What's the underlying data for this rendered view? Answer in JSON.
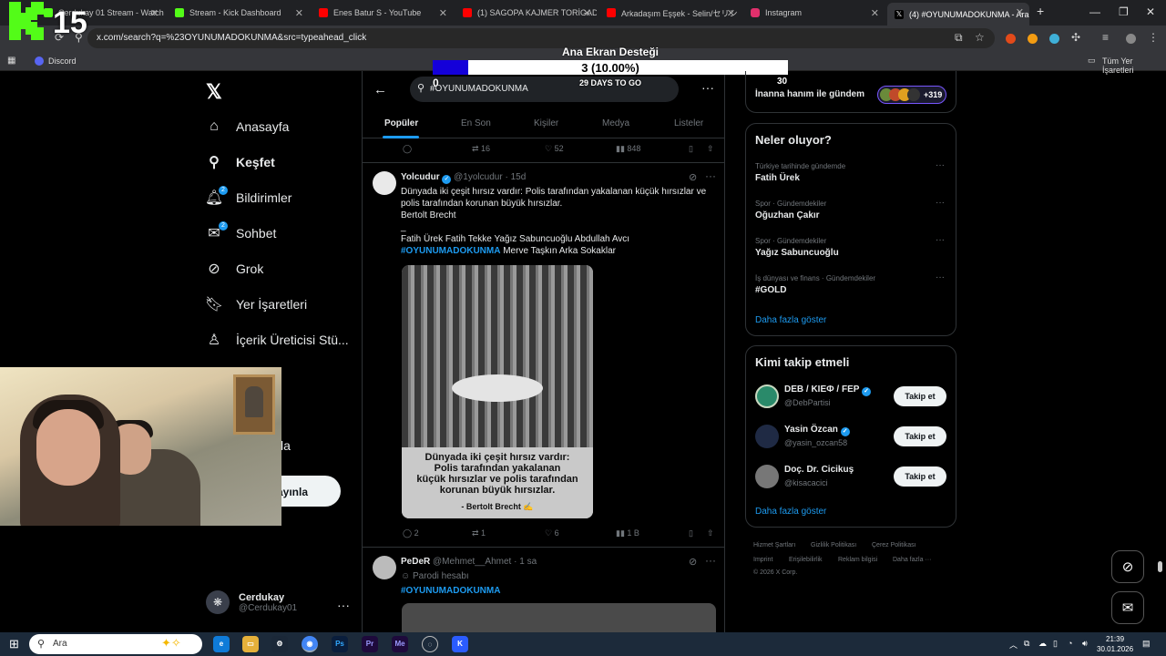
{
  "browser": {
    "tabs": [
      {
        "title": "Cerdukay 01 Stream - Watch Live",
        "color": "#53fc18"
      },
      {
        "title": "Stream - Kick Dashboard",
        "color": "#53fc18"
      },
      {
        "title": "Enes Batur S - YouTube",
        "color": "#ff0000"
      },
      {
        "title": "(1) SAGOPA KAJMER TORİGADİ",
        "color": "#ff0000"
      },
      {
        "title": "Arkadaşım Eşşek - Selin/セリン",
        "color": "#ff0000"
      },
      {
        "title": "Instagram",
        "color": "#e1306c"
      },
      {
        "title": "(4) #OYUNUMADOKUNMA - Arama",
        "color": "#ffffff"
      }
    ],
    "new_tab": "+",
    "url": "x.com/search?q=%23OYUNUMADOKUNMA&src=typeahead_click",
    "bookmarks": [
      {
        "label": "Discord"
      }
    ],
    "all_bookmarks": "Tüm Yer İşaretleri"
  },
  "overlay": {
    "kick_counter": "15",
    "goal_title": "Ana Ekran Desteği",
    "goal_text": "3 (10.00%)",
    "goal_fraction": 0.1,
    "goal_start": "0",
    "goal_end": "30",
    "goal_days": "29 DAYS TO GO"
  },
  "nav": {
    "items": [
      {
        "label": "Anasayfa",
        "icon": "home-icon",
        "badge": ""
      },
      {
        "label": "Keşfet",
        "icon": "search-icon",
        "badge": ""
      },
      {
        "label": "Bildirimler",
        "icon": "bell-icon",
        "badge": "2"
      },
      {
        "label": "Sohbet",
        "icon": "mail-icon",
        "badge": "2"
      },
      {
        "label": "Grok",
        "icon": "grok-icon",
        "badge": ""
      },
      {
        "label": "Yer İşaretleri",
        "icon": "bookmark-icon",
        "badge": ""
      },
      {
        "label": "İçerik Üreticisi Stü...",
        "icon": "creator-studio-icon",
        "badge": ""
      }
    ],
    "hidden_fragment": "la",
    "post_button": "ayınla",
    "account_name": "Cerdukay",
    "account_handle": "@Cerdukay01"
  },
  "search": {
    "query": "#OYUNUMADOKUNMA",
    "tabs": [
      "Popüler",
      "En Son",
      "Kişiler",
      "Medya",
      "Listeler"
    ]
  },
  "tweets": [
    {
      "reply_count": "",
      "retweet_count": "16",
      "like_count": "52",
      "view_count": "848"
    },
    {
      "name": "Yolcudur",
      "handle": "@1yolcudur",
      "time": "15d",
      "lines": [
        "Dünyada iki çeşit hırsız vardır: Polis tarafından yakalanan küçük hırsızlar ve",
        "polis tarafından korunan büyük hırsızlar.",
        "Bertolt Brecht",
        "_",
        "Fatih Ürek Fatih Tekke Yağız Sabuncuoğlu Abdullah Avcı"
      ],
      "hashtag": "#OYUNUMADOKUNMA",
      "tail": " Merve Taşkın Arka Sokaklar",
      "image_caption": [
        "Dünyada iki çeşit hırsız vardır:",
        "Polis tarafından yakalanan",
        "küçük hırsızlar ve polis tarafından",
        "korunan büyük hırsızlar."
      ],
      "image_author": "- Bertolt Brecht ✍",
      "reply_count": "2",
      "retweet_count": "1",
      "like_count": "6",
      "view_count": "1 B"
    },
    {
      "name": "PeDeR",
      "handle": "@Mehmet__Ahmet",
      "time": "1 sa",
      "label": "Parodi hesabı",
      "hashtag": "#OYUNUMADOKUNMA"
    }
  ],
  "right": {
    "top_card": {
      "name": "İnanna hanım ile gündem",
      "count": "+319"
    },
    "trends_title": "Neler oluyor?",
    "trends": [
      {
        "category": "Türkiye tarihinde gündemde",
        "name": "Fatih Ürek"
      },
      {
        "category": "Spor · Gündemdekiler",
        "name": "Oğuzhan Çakır"
      },
      {
        "category": "Spor · Gündemdekiler",
        "name": "Yağız Sabuncuoğlu"
      },
      {
        "category": "İş dünyası ve finans · Gündemdekiler",
        "name": "#GOLD"
      }
    ],
    "show_more": "Daha fazla göster",
    "follow_title": "Kimi takip etmeli",
    "follow": [
      {
        "name": "DEB / KIEФ / FEP",
        "handle": "@DebPartisi",
        "color": "#1e6b4f"
      },
      {
        "name": "Yasin Özcan",
        "handle": "@yasin_ozcan58",
        "color": "#1f2a44"
      },
      {
        "name": "Doç. Dr. Cicikuş",
        "handle": "@kisacacici",
        "color": "#777777"
      }
    ],
    "follow_button": "Takip et",
    "footer": [
      "Hizmet Şartları",
      "Gizlilik Politikası",
      "Çerez Politikası",
      "Imprint",
      "Erişilebilirlik",
      "Reklam bilgisi",
      "Daha fazla ···",
      "© 2026 X Corp."
    ]
  },
  "taskbar": {
    "search_placeholder": "Ara",
    "time": "21:39",
    "date": "30.01.2026"
  },
  "colors": {
    "accent": "#1d9bf0",
    "background": "#000000",
    "goal_fill": "#1400d9"
  }
}
